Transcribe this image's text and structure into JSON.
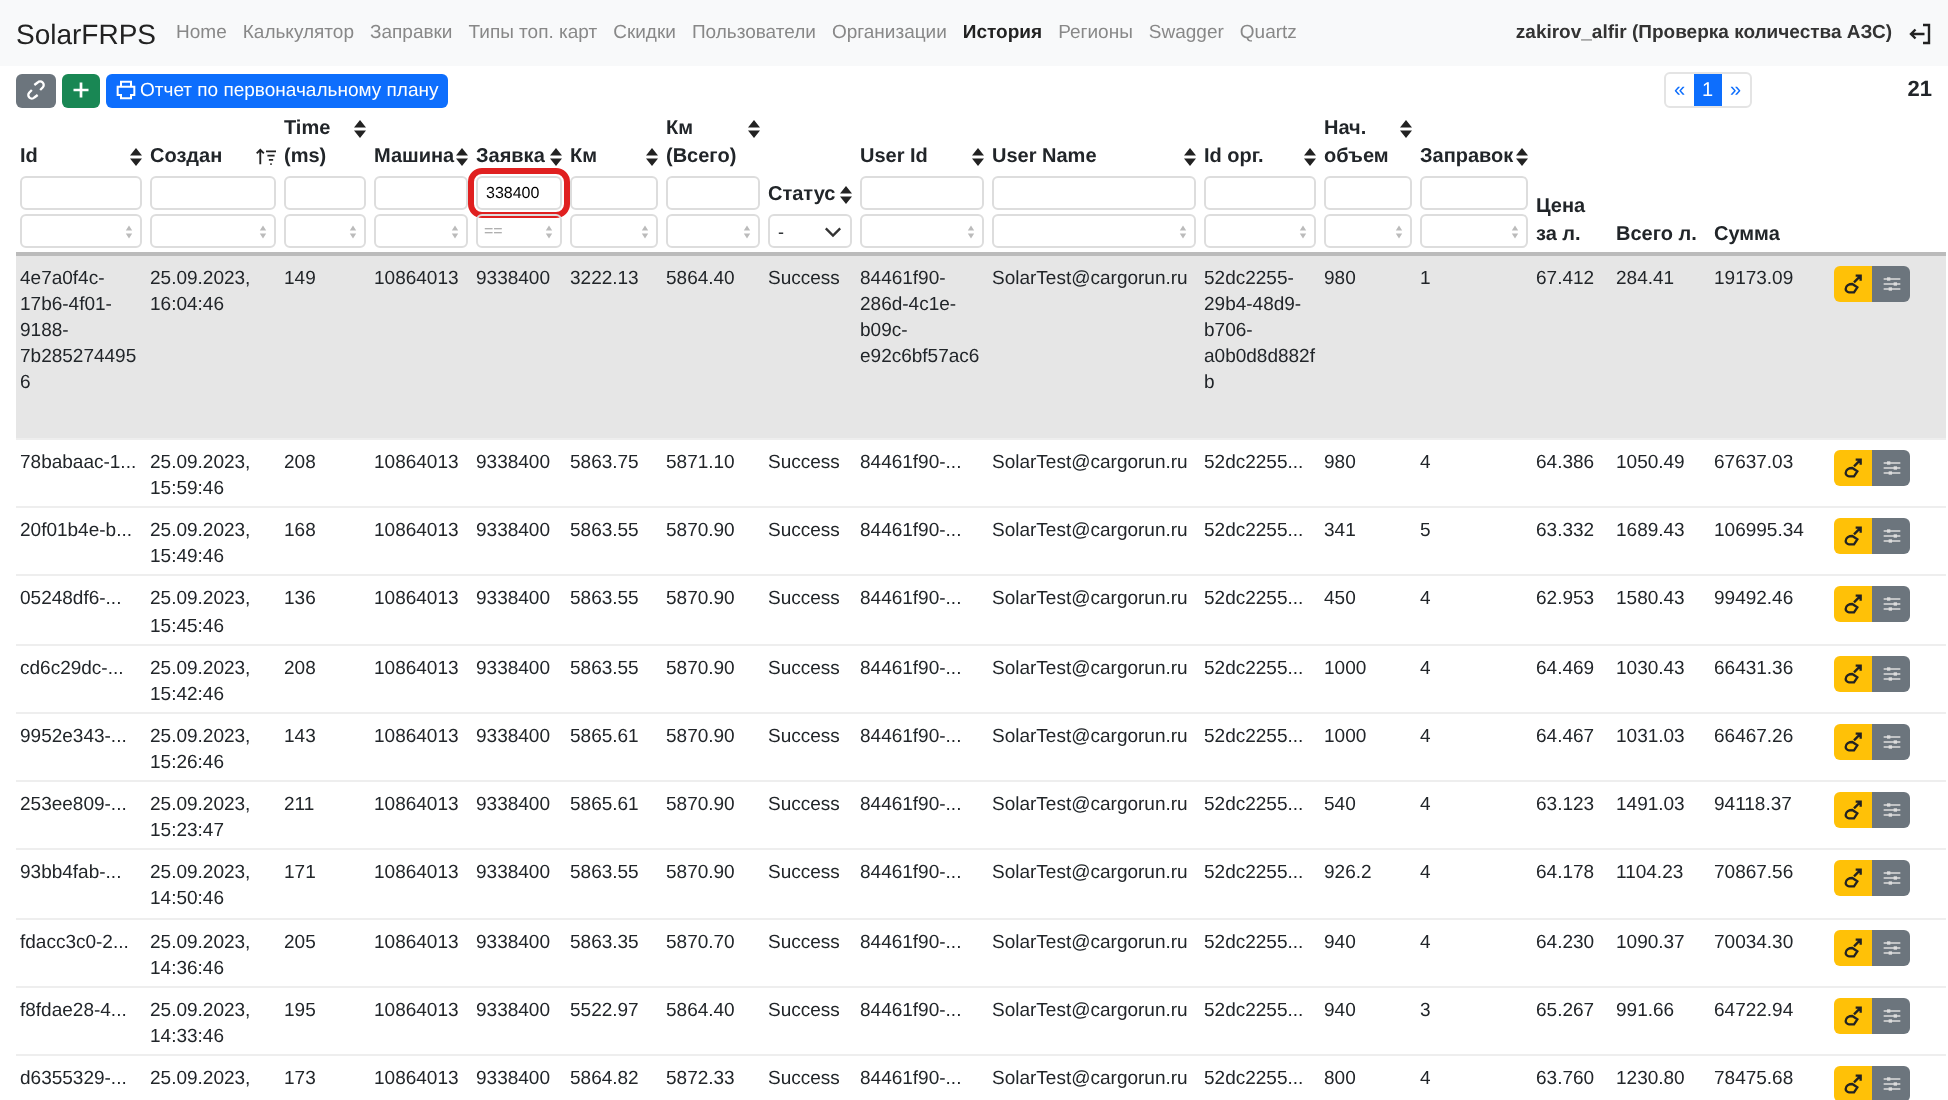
{
  "navbar": {
    "brand": "SolarFRPS",
    "items": [
      {
        "label": "Home",
        "selected": false
      },
      {
        "label": "Калькулятор",
        "selected": false
      },
      {
        "label": "Заправки",
        "selected": false
      },
      {
        "label": "Типы топ. карт",
        "selected": false
      },
      {
        "label": "Скидки",
        "selected": false
      },
      {
        "label": "Пользователи",
        "selected": false
      },
      {
        "label": "Организации",
        "selected": false
      },
      {
        "label": "История",
        "selected": true
      },
      {
        "label": "Регионы",
        "selected": false
      },
      {
        "label": "Swagger",
        "selected": false
      },
      {
        "label": "Quartz",
        "selected": false
      }
    ],
    "user": "zakirov_alfir (Проверка количества АЗС)"
  },
  "toolbar": {
    "report_button": "Отчет по первоначальному плану",
    "pagination": [
      {
        "label": "«",
        "selected": false
      },
      {
        "label": "1",
        "selected": true
      },
      {
        "label": "»",
        "selected": false
      }
    ],
    "total": "21"
  },
  "table": {
    "columns": [
      {
        "label": "Id",
        "sortable": true,
        "sorted": false,
        "kind": "text"
      },
      {
        "label": "Создан",
        "sortable": true,
        "sorted": true,
        "kind": "text"
      },
      {
        "label": "Time (ms)",
        "sortable": true,
        "sorted": false,
        "kind": "text"
      },
      {
        "label": "Машина",
        "sortable": true,
        "sorted": false,
        "kind": "text"
      },
      {
        "label": "Заявка",
        "sortable": true,
        "sorted": false,
        "kind": "text",
        "value": "338400",
        "placeholder": "==",
        "highlighted": true
      },
      {
        "label": "Км",
        "sortable": true,
        "sorted": false,
        "kind": "text"
      },
      {
        "label": "Км (Всего)",
        "sortable": true,
        "sorted": false,
        "kind": "text"
      },
      {
        "label": "Статус",
        "sortable": true,
        "sorted": false,
        "kind": "select",
        "value": "-"
      },
      {
        "label": "User Id",
        "sortable": true,
        "sorted": false,
        "kind": "text"
      },
      {
        "label": "User Name",
        "sortable": true,
        "sorted": false,
        "kind": "text"
      },
      {
        "label": "Id орг.",
        "sortable": true,
        "sorted": false,
        "kind": "text"
      },
      {
        "label": "Нач. объем",
        "sortable": true,
        "sorted": false,
        "kind": "text"
      },
      {
        "label": "Заправок",
        "sortable": true,
        "sorted": false,
        "kind": "text"
      },
      {
        "label": "Цена за л.",
        "sortable": false,
        "kind": "plain"
      },
      {
        "label": "Всего л.",
        "sortable": false,
        "kind": "plain"
      },
      {
        "label": "Сумма",
        "sortable": false,
        "kind": "plain"
      }
    ],
    "rows": [
      {
        "selected": true,
        "cells": [
          "4e7a0f4c-17b6-4f01-9188-7b2852744956",
          "25.09.2023, 16:04:46",
          "149",
          "10864013",
          "9338400",
          "3222.13",
          "5864.40",
          "Success",
          "84461f90-286d-4c1e-b09c-e92c6bf57ac6",
          "SolarTest@cargorun.ru",
          "52dc2255-29b4-48d9-b706-a0b0d8d882fb",
          "980",
          "1",
          "67.412",
          "284.41",
          "19173.09"
        ]
      },
      {
        "selected": false,
        "cells": [
          "78babaac-1...",
          "25.09.2023, 15:59:46",
          "208",
          "10864013",
          "9338400",
          "5863.75",
          "5871.10",
          "Success",
          "84461f90-...",
          "SolarTest@cargorun.ru",
          "52dc2255...",
          "980",
          "4",
          "64.386",
          "1050.49",
          "67637.03"
        ]
      },
      {
        "selected": false,
        "cells": [
          "20f01b4e-b...",
          "25.09.2023, 15:49:46",
          "168",
          "10864013",
          "9338400",
          "5863.55",
          "5870.90",
          "Success",
          "84461f90-...",
          "SolarTest@cargorun.ru",
          "52dc2255...",
          "341",
          "5",
          "63.332",
          "1689.43",
          "106995.34"
        ]
      },
      {
        "selected": false,
        "cells": [
          "05248df6-...",
          "25.09.2023, 15:45:46",
          "136",
          "10864013",
          "9338400",
          "5863.55",
          "5870.90",
          "Success",
          "84461f90-...",
          "SolarTest@cargorun.ru",
          "52dc2255...",
          "450",
          "4",
          "62.953",
          "1580.43",
          "99492.46"
        ]
      },
      {
        "selected": false,
        "cells": [
          "cd6c29dc-...",
          "25.09.2023, 15:42:46",
          "208",
          "10864013",
          "9338400",
          "5863.55",
          "5870.90",
          "Success",
          "84461f90-...",
          "SolarTest@cargorun.ru",
          "52dc2255...",
          "1000",
          "4",
          "64.469",
          "1030.43",
          "66431.36"
        ]
      },
      {
        "selected": false,
        "cells": [
          "9952e343-...",
          "25.09.2023, 15:26:46",
          "143",
          "10864013",
          "9338400",
          "5865.61",
          "5870.90",
          "Success",
          "84461f90-...",
          "SolarTest@cargorun.ru",
          "52dc2255...",
          "1000",
          "4",
          "64.467",
          "1031.03",
          "66467.26"
        ]
      },
      {
        "selected": false,
        "cells": [
          "253ee809-...",
          "25.09.2023, 15:23:47",
          "211",
          "10864013",
          "9338400",
          "5865.61",
          "5870.90",
          "Success",
          "84461f90-...",
          "SolarTest@cargorun.ru",
          "52dc2255...",
          "540",
          "4",
          "63.123",
          "1491.03",
          "94118.37"
        ]
      },
      {
        "selected": false,
        "cells": [
          "93bb4fab-...",
          "25.09.2023, 14:50:46",
          "171",
          "10864013",
          "9338400",
          "5863.55",
          "5870.90",
          "Success",
          "84461f90-...",
          "SolarTest@cargorun.ru",
          "52dc2255...",
          "926.2",
          "4",
          "64.178",
          "1104.23",
          "70867.56"
        ]
      },
      {
        "selected": false,
        "cells": [
          "fdacc3c0-2...",
          "25.09.2023, 14:36:46",
          "205",
          "10864013",
          "9338400",
          "5863.35",
          "5870.70",
          "Success",
          "84461f90-...",
          "SolarTest@cargorun.ru",
          "52dc2255...",
          "940",
          "4",
          "64.230",
          "1090.37",
          "70034.30"
        ]
      },
      {
        "selected": false,
        "cells": [
          "f8fdae28-4...",
          "25.09.2023, 14:33:46",
          "195",
          "10864013",
          "9338400",
          "5522.97",
          "5864.40",
          "Success",
          "84461f90-...",
          "SolarTest@cargorun.ru",
          "52dc2255...",
          "940",
          "3",
          "65.267",
          "991.66",
          "64722.94"
        ]
      },
      {
        "selected": false,
        "cells": [
          "d6355329-...",
          "25.09.2023,",
          "173",
          "10864013",
          "9338400",
          "5864.82",
          "5872.33",
          "Success",
          "84461f90-...",
          "SolarTest@cargorun.ru",
          "52dc2255...",
          "800",
          "4",
          "63.760",
          "1230.80",
          "78475.68"
        ]
      }
    ]
  }
}
